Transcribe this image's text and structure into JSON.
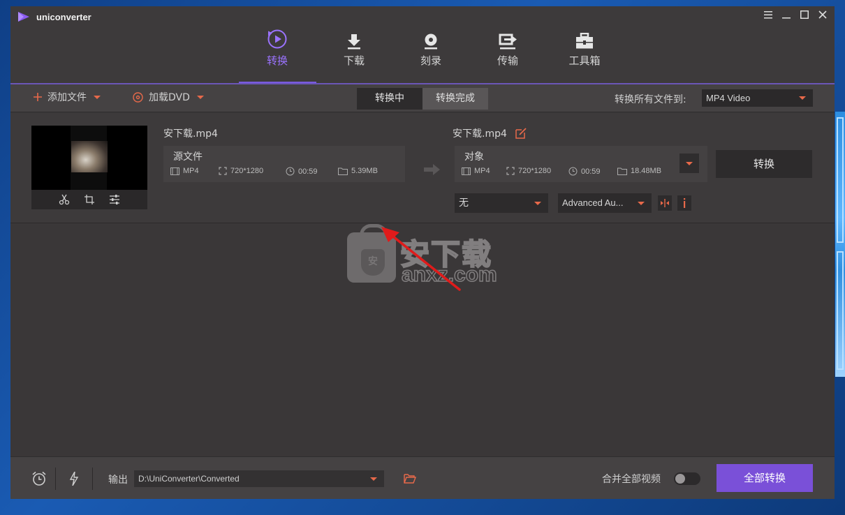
{
  "app": {
    "title": "uniconverter"
  },
  "nav": {
    "items": [
      {
        "label": "转换",
        "icon": "convert-icon",
        "active": true
      },
      {
        "label": "下载",
        "icon": "download-icon",
        "active": false
      },
      {
        "label": "刻录",
        "icon": "burn-disc-icon",
        "active": false
      },
      {
        "label": "传输",
        "icon": "transfer-icon",
        "active": false
      },
      {
        "label": "工具箱",
        "icon": "toolbox-icon",
        "active": false
      }
    ]
  },
  "toolbar": {
    "add_files": "添加文件",
    "load_dvd": "加载DVD",
    "tab_converting": "转换中",
    "tab_converted": "转换完成",
    "convert_all_to_label": "转换所有文件到:",
    "format_value": "MP4 Video"
  },
  "file": {
    "source": {
      "name": "安下载.mp4",
      "box_title": "源文件",
      "format": "MP4",
      "resolution": "720*1280",
      "duration": "00:59",
      "size": "5.39MB"
    },
    "target": {
      "name": "安下载.mp4",
      "box_title": "对象",
      "format": "MP4",
      "resolution": "720*1280",
      "duration": "00:59",
      "size": "18.48MB"
    },
    "convert_button": "转换",
    "subtitle_value": "无",
    "audio_value": "Advanced Au..."
  },
  "watermark": {
    "cn": "安下载",
    "en": "anxz.com",
    "shield": "安"
  },
  "bottom": {
    "output_label": "输出",
    "output_path": "D:\\UniConverter\\Converted",
    "merge_label": "合并全部视频",
    "merge_enabled": false,
    "convert_all_button": "全部转换"
  },
  "colors": {
    "accent_purple": "#7a50d8",
    "accent_orange": "#e8694a",
    "window_bg": "#3a3738"
  }
}
